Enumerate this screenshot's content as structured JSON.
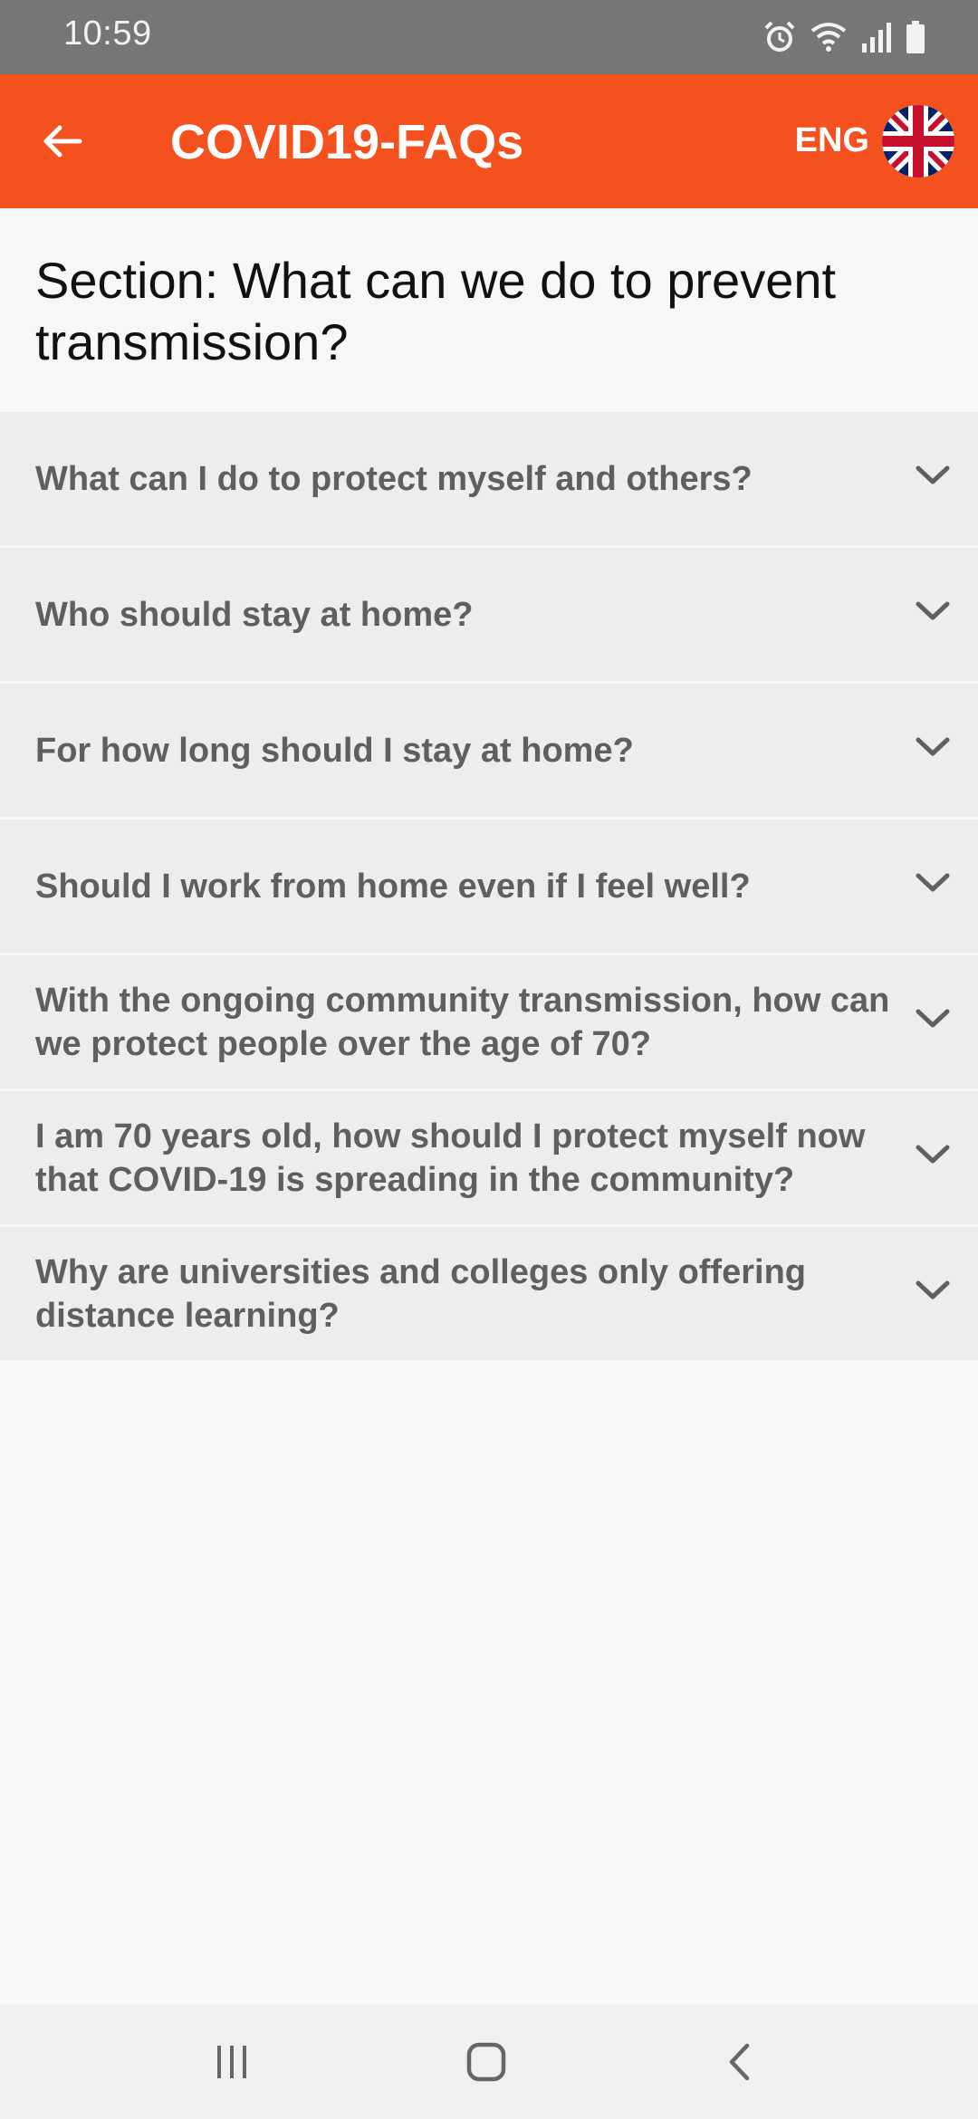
{
  "status_bar": {
    "time": "10:59",
    "icons": [
      "alarm-icon",
      "wifi-icon",
      "signal-icon",
      "battery-icon"
    ]
  },
  "app_bar": {
    "title": "COVID19-FAQs",
    "language": "ENG",
    "back_icon": "arrow-left-icon",
    "flag_icon": "uk-flag-icon",
    "color": "#f4511e"
  },
  "section": {
    "title": "Section: What can we do to prevent transmission?"
  },
  "faqs": [
    {
      "question": "What can I do to protect myself and others?"
    },
    {
      "question": "Who should stay at home?"
    },
    {
      "question": "For how long should I stay at home?"
    },
    {
      "question": "Should I work from home even if I feel well?"
    },
    {
      "question": "With the ongoing community transmission, how can we protect people over the age of 70?"
    },
    {
      "question": "I am 70 years old, how should I protect myself now that COVID-19 is spreading in the community?"
    },
    {
      "question": "Why are universities and colleges only offering distance learning?"
    }
  ],
  "nav_bar": {
    "buttons": [
      "recent-apps-icon",
      "home-icon",
      "back-icon"
    ]
  }
}
